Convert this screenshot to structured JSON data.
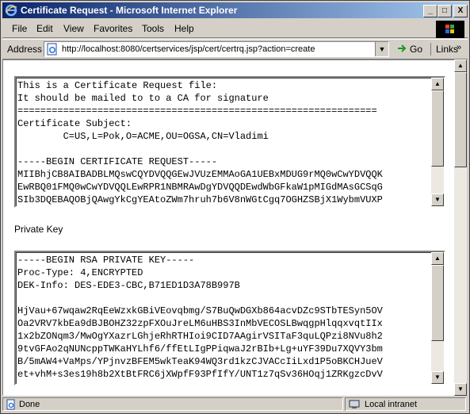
{
  "window": {
    "title": "Certificate Request - Microsoft Internet Explorer",
    "controls": {
      "minimize": "_",
      "maximize": "□",
      "close": "X"
    }
  },
  "menu": {
    "items": [
      {
        "label": "File",
        "key": "F"
      },
      {
        "label": "Edit",
        "key": "E"
      },
      {
        "label": "View",
        "key": "V"
      },
      {
        "label": "Favorites",
        "key": "a"
      },
      {
        "label": "Tools",
        "key": "T"
      },
      {
        "label": "Help",
        "key": "H"
      }
    ]
  },
  "address": {
    "label": "Address",
    "url": "http://localhost:8080/certservices/jsp/cert/certrq.jsp?action=create",
    "go_label": "Go",
    "links_label": "Links",
    "links_chevron": "»"
  },
  "request_text": "This is a Certificate Request file:\nIt should be mailed to to a CA for signature\n===============================================================\nCertificate Subject:\n        C=US,L=Pok,O=ACME,OU=OGSA,CN=Vladimi\n\n-----BEGIN CERTIFICATE REQUEST-----\nMIIBhjCB8AIBADBLMQswCQYDVQQGEwJVUzEMMAoGA1UEBxMDUG9rMQ0wCwYDVQQK\nEwRBQ01FMQ0wCwYDVQQLEwRPR1NBMRAwDgYDVQQDEwdWbGFkaW1pMIGdMAsGCSqG\nSIb3DQEBAQOBjQAwgYkCgYEAtoZWm7hruh7b6V8nWGtCgq7OGHZSBjX1WybmVUXP",
  "private_key": {
    "label": "Private Key",
    "text": "-----BEGIN RSA PRIVATE KEY-----\nProc-Type: 4,ENCRYPTED\nDEK-Info: DES-EDE3-CBC,B71ED1D3A78B997B\n\nHjVau+67wqaw2RqEeWzxkGBiVEovqbmg/S7BuQwDGXb864acvDZc9STbTESyn5OV\nOa2VRV7kbEa9dBJBOHZ32zpFXOuJreLM6uHBS3InMbVECOSLBwqgpHlqqxvqtIIx\n1x2bZONqm3/MwOgYXazrLGhjeRhRTHIoi9CID7AAgirVSITaF3quLQPzi8NVu8h2\n9tvGFAo2qNUNcppTWKaHYLhf6/ffEtLIgPPiqwaJ2rBIb+Lg+uYF39Du7XQVY3bm\nB/5mAW4+VaMps/YPjnvzBFEM5wkTeaK94WQ3rd1kzCJVACcIiLxd1P5oBKCHJueV\net+vhM+s3es19h8b2XtBtFRC6jXWpfF93PfIfY/UNT1z7qSv36HOqj1ZRKgzcDvV"
  },
  "status": {
    "text": "Done",
    "zone": "Local intranet"
  }
}
